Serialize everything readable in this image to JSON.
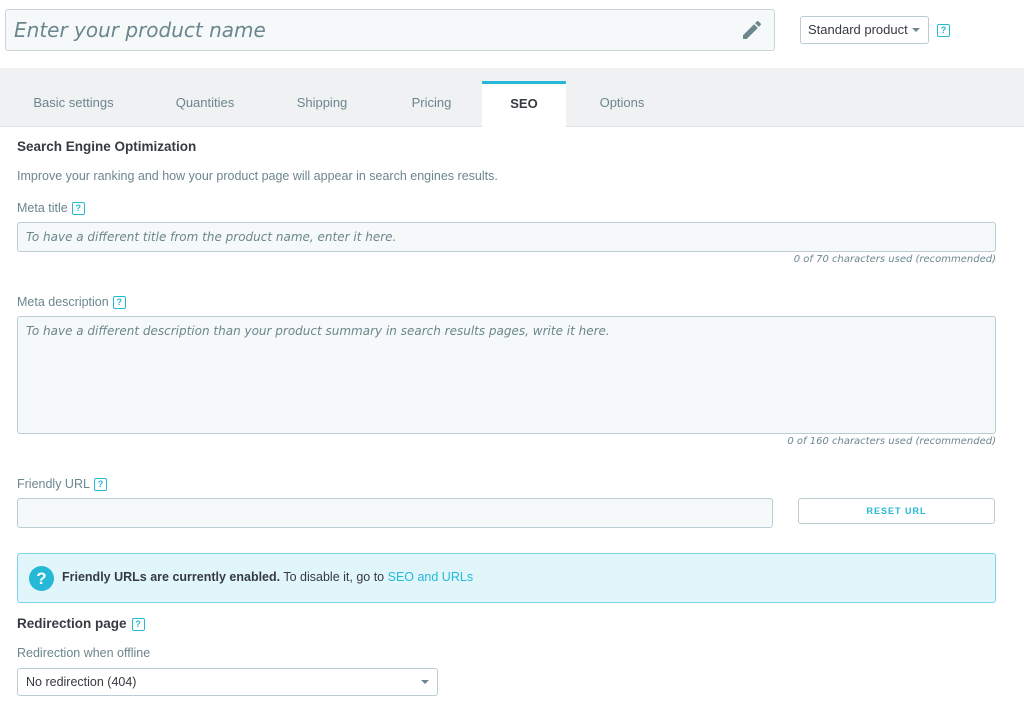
{
  "header": {
    "product_name_placeholder": "Enter your product name",
    "product_type": "Standard product",
    "help_label": "?"
  },
  "tabs": [
    {
      "label": "Basic settings",
      "active": false
    },
    {
      "label": "Quantities",
      "active": false
    },
    {
      "label": "Shipping",
      "active": false
    },
    {
      "label": "Pricing",
      "active": false
    },
    {
      "label": "SEO",
      "active": true
    },
    {
      "label": "Options",
      "active": false
    }
  ],
  "seo": {
    "title": "Search Engine Optimization",
    "description": "Improve your ranking and how your product page will appear in search engines results.",
    "meta_title": {
      "label": "Meta title",
      "placeholder": "To have a different title from the product name, enter it here.",
      "counter": "0 of 70 characters used (recommended)"
    },
    "meta_description": {
      "label": "Meta description",
      "placeholder": "To have a different description than your product summary in search results pages, write it here.",
      "counter": "0 of 160 characters used (recommended)"
    },
    "friendly_url": {
      "label": "Friendly URL",
      "value": "",
      "reset_label": "RESET URL"
    },
    "alert": {
      "icon": "?",
      "bold_text": "Friendly URLs are currently enabled.",
      "text": " To disable it, go to ",
      "link_text": "SEO and URLs"
    },
    "redirection": {
      "title": "Redirection page",
      "label": "Redirection when offline",
      "selected": "No redirection (404)"
    }
  },
  "colors": {
    "accent": "#25b9d7",
    "text": "#363a41",
    "muted": "#6c868e",
    "alert_bg": "#e1f6fb"
  }
}
